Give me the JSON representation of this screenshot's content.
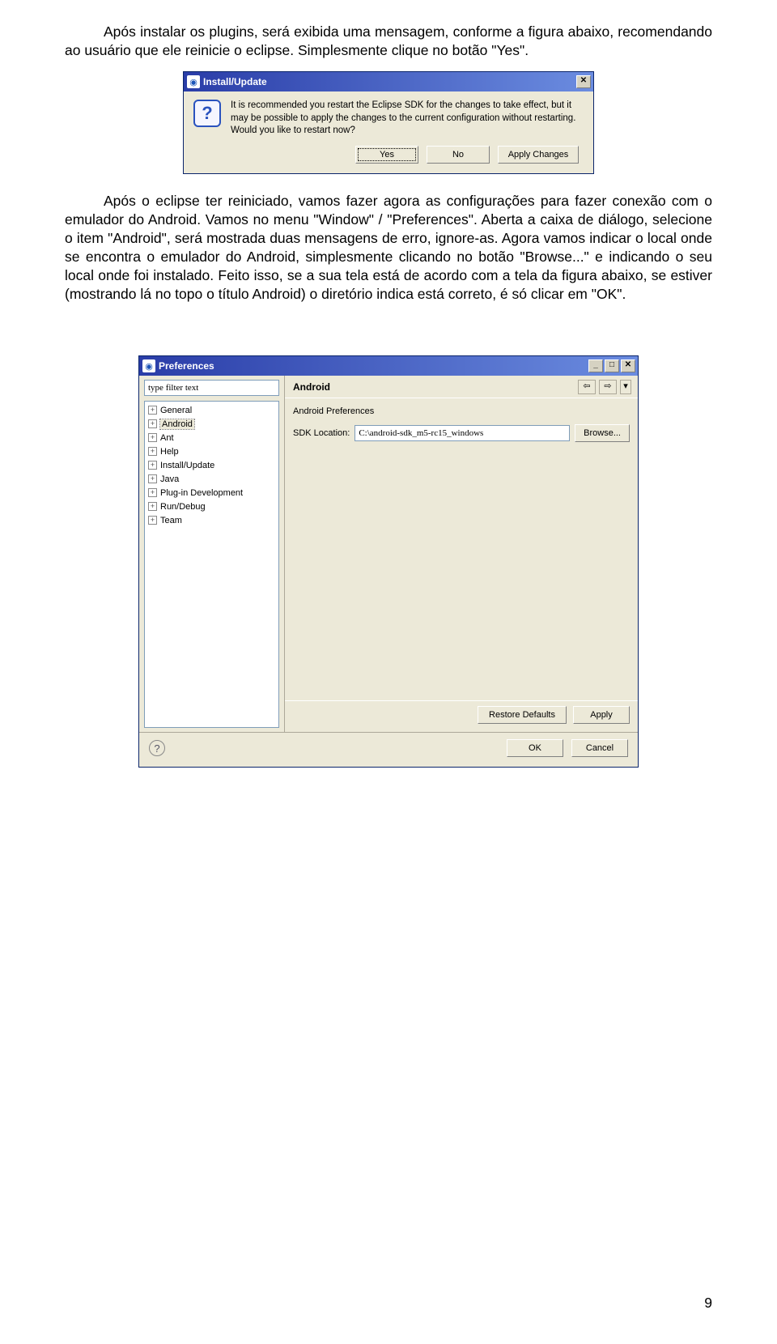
{
  "paragraphs": {
    "p1": "Após instalar os plugins, será exibida uma mensagem, conforme a figura abaixo, recomendando ao usuário que ele reinicie o eclipse. Simplesmente clique no botão \"Yes\".",
    "p2": "Após o eclipse ter reiniciado, vamos fazer agora as configurações para fazer conexão com o emulador do Android. Vamos no menu \"Window\" / \"Preferences\". Aberta a caixa de diálogo, selecione o item \"Android\", será mostrada duas mensagens de erro, ignore-as. Agora vamos indicar o local onde se encontra  o emulador do Android, simplesmente clicando no botão \"Browse...\" e indicando o seu local onde foi instalado. Feito isso, se a sua tela está de acordo com a tela da figura abaixo, se estiver (mostrando lá no topo o título Android) o diretório indica está correto, é só clicar em \"OK\"."
  },
  "dialog1": {
    "title": "Install/Update",
    "message": "It is recommended you restart the Eclipse SDK for the changes to take effect, but it may be possible to apply the changes to the current configuration without restarting. Would you like to restart now?",
    "buttons": {
      "yes": "Yes",
      "no": "No",
      "apply": "Apply Changes"
    }
  },
  "dialog2": {
    "title": "Preferences",
    "filter_placeholder": "type filter text",
    "tree": [
      "General",
      "Android",
      "Ant",
      "Help",
      "Install/Update",
      "Java",
      "Plug-in Development",
      "Run/Debug",
      "Team"
    ],
    "selected": "Android",
    "heading": "Android",
    "section_label": "Android Preferences",
    "sdk_label": "SDK Location:",
    "sdk_value": "C:\\android-sdk_m5-rc15_windows",
    "browse": "Browse...",
    "restore": "Restore Defaults",
    "apply": "Apply",
    "ok": "OK",
    "cancel": "Cancel"
  },
  "page_number": "9"
}
